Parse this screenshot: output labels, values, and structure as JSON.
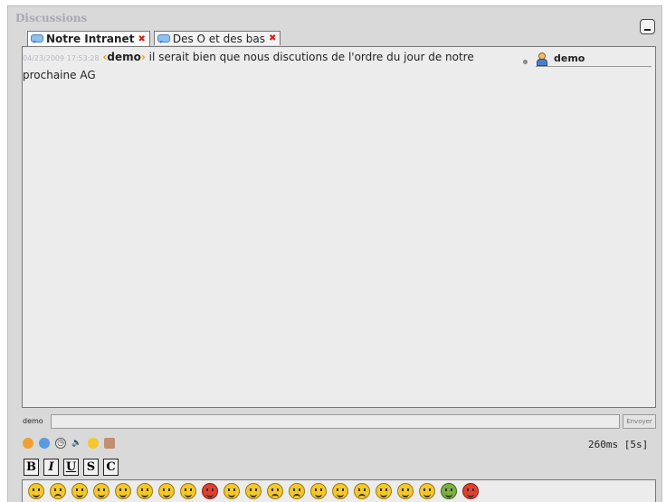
{
  "panel": {
    "title": "Discussions"
  },
  "tabs": [
    {
      "label": "Notre Intranet",
      "active": true
    },
    {
      "label": "Des O et des bas",
      "active": false
    }
  ],
  "messages": [
    {
      "time": "04/23/2009 17:53:28",
      "open_bracket": "‹",
      "nick": "demo",
      "close_bracket": "›",
      "text": " il serait bien que nous discutions de l'ordre du jour de notre prochaine AG"
    }
  ],
  "users": [
    {
      "name": "demo"
    }
  ],
  "input": {
    "nick_label": "demo",
    "value": "",
    "send_label": "Envoyer"
  },
  "status": {
    "latency": "260ms [5s]"
  },
  "format_buttons": [
    "B",
    "I",
    "U",
    "S",
    "C"
  ],
  "tool_icons": [
    "color-palette-icon",
    "world-icon",
    "clock-icon",
    "speaker-icon",
    "smiley-icon",
    "user-icon"
  ],
  "smileys": [
    "smile",
    "sad",
    "grin",
    "tongue",
    "wink",
    "surprised",
    "cool",
    "shocked",
    "angry",
    "nerd",
    "blush",
    "sleepy",
    "cry",
    "laugh",
    "kiss",
    "confused",
    "love",
    "evil",
    "party",
    "sick",
    "devil"
  ],
  "colors": {
    "panel_bg": "#d9d9d9",
    "area_bg": "#ececec",
    "nick_bracket": "#e0a000",
    "tab_close": "#d02020"
  }
}
